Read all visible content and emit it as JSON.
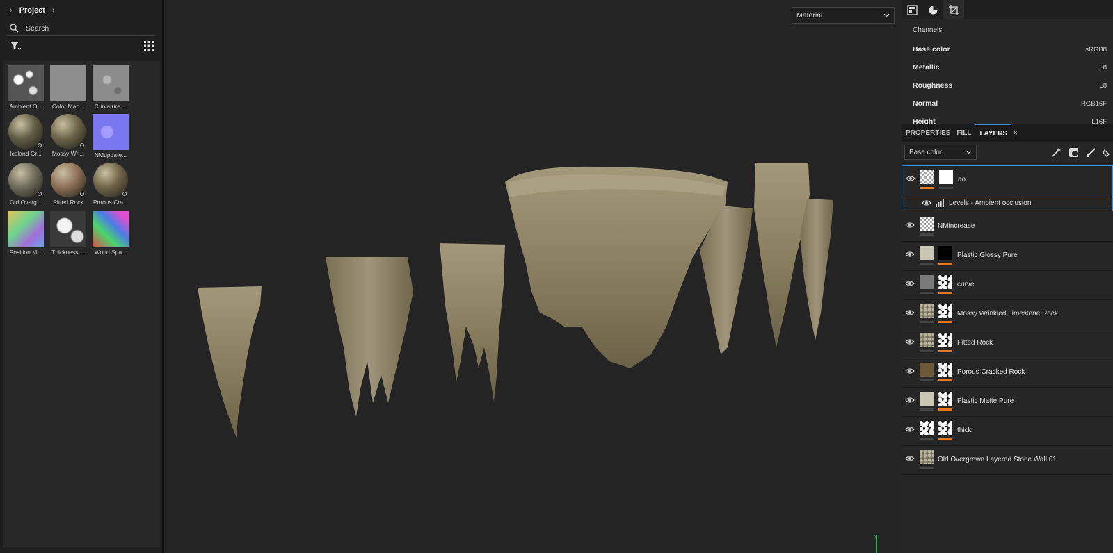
{
  "project": {
    "title": "Project",
    "search_label": "Search"
  },
  "assets": [
    {
      "label": "Ambient O...",
      "kind": "ao"
    },
    {
      "label": "Color Map...",
      "kind": "grey"
    },
    {
      "label": "Curvature ...",
      "kind": "curv"
    },
    {
      "label": "Iceland Gr...",
      "kind": "sphere",
      "color": "#5f5b43"
    },
    {
      "label": "Mossy Wri...",
      "kind": "sphere",
      "color": "#6b6449"
    },
    {
      "label": "NMupdate...",
      "kind": "normal"
    },
    {
      "label": "Old Overg...",
      "kind": "sphere",
      "color": "#6c6a5a"
    },
    {
      "label": "Pitted Rock",
      "kind": "sphere",
      "color": "#8c6f55"
    },
    {
      "label": "Porous Cra...",
      "kind": "sphere",
      "color": "#6f6248"
    },
    {
      "label": "Position M...",
      "kind": "position"
    },
    {
      "label": "Thickness ...",
      "kind": "thick"
    },
    {
      "label": "World Spa...",
      "kind": "world"
    }
  ],
  "viewport": {
    "material_mode": "Material"
  },
  "channels": {
    "title": "Channels",
    "rows": [
      {
        "name": "Base color",
        "format": "sRGB8"
      },
      {
        "name": "Metallic",
        "format": "L8"
      },
      {
        "name": "Roughness",
        "format": "L8"
      },
      {
        "name": "Normal",
        "format": "RGB16F"
      },
      {
        "name": "Height",
        "format": "L16F"
      }
    ]
  },
  "panel_tabs": {
    "properties": "PROPERTIES - FILL",
    "layers": "LAYERS"
  },
  "layer_channel": "Base color",
  "layers": [
    {
      "name": "ao",
      "thumb": "checker",
      "mask": "white",
      "bar1": "or",
      "bar2": "grey",
      "selected": true
    },
    {
      "name": "Levels - Ambient occlusion",
      "effect": true
    },
    {
      "name": "NMincrease",
      "thumb": "checker",
      "bar1": "grey"
    },
    {
      "name": "Plastic Glossy Pure",
      "thumb": "#c9c6b6",
      "mask": "black",
      "bar1": "grey",
      "bar2": "or"
    },
    {
      "name": "curve",
      "thumb": "#7a7a7a",
      "mask": "noise",
      "bar1": "grey",
      "bar2": "or"
    },
    {
      "name": "Mossy Wrinkled Limestone Rock",
      "thumb": "stone",
      "mask": "noise",
      "bar1": "grey",
      "bar2": "or"
    },
    {
      "name": "Pitted Rock",
      "thumb": "stone",
      "mask": "noise",
      "bar1": "grey",
      "bar2": "or"
    },
    {
      "name": "Porous Cracked Rock",
      "thumb": "#6d5838",
      "mask": "noise",
      "bar1": "grey",
      "bar2": "or"
    },
    {
      "name": "Plastic Matte Pure",
      "thumb": "#c8c6b5",
      "mask": "noise",
      "bar1": "grey",
      "bar2": "or"
    },
    {
      "name": "thick",
      "thumb": "noise",
      "mask": "noise",
      "bar1": "grey",
      "bar2": "or"
    },
    {
      "name": "Old Overgrown Layered Stone Wall 01",
      "thumb": "stone",
      "bar1": "grey"
    }
  ],
  "accent": "#e87a1b",
  "selection_color": "#2d8fe6"
}
